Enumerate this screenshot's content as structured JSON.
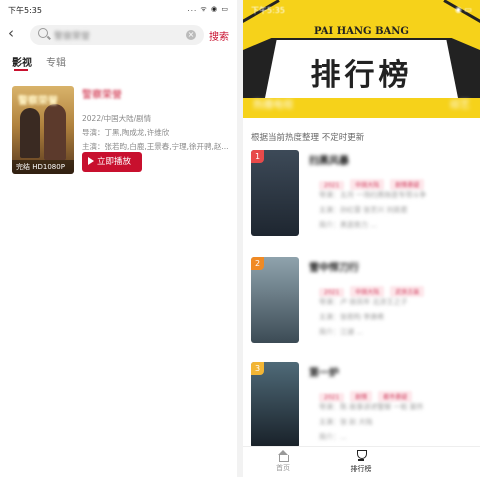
{
  "left": {
    "status": {
      "time": "下午5:35",
      "icons": "... ᯤ ◉ ▭"
    },
    "search": {
      "query": "警察荣誉",
      "action_label": "搜索"
    },
    "tabs": [
      {
        "label": "影视"
      },
      {
        "label": "专辑"
      }
    ],
    "result": {
      "title": "警察荣誉",
      "poster_title": "警察荣誉",
      "badge": "完结 HD1080P",
      "meta": "2022/中国大陆/剧情",
      "director": "导演：丁黑,陶成龙,许维欣",
      "cast": "主演：张若昀,白鹿,王景春,宁理,徐开骋,赵...",
      "play_label": "立即播放"
    }
  },
  "right": {
    "status": {
      "time": "下午5:35",
      "icons": "◉ ▭"
    },
    "banner": {
      "en_title": "PAI HANG BANG",
      "cn_title": "排行榜",
      "left_tab": "热播电视",
      "right_tab": "综艺"
    },
    "subtitle": "根据当前热度整理 不定时更新",
    "items": [
      {
        "rank": "1",
        "title": "扫黑风暴",
        "tags": [
          "2021",
          "中国大陆",
          "剧情悬疑"
        ],
        "desc": [
          "导演：五月 一场扫黑除恶专项斗争",
          "主演：孙红雷 张艺兴 刘奕君",
          "简介：黑恶势力 ..."
        ],
        "rank_color": "#e84a4a",
        "poster_colors": [
          "#3d4a58",
          "#1e2630"
        ]
      },
      {
        "rank": "2",
        "title": "雪中悍刀行",
        "tags": [
          "2021",
          "中国大陆",
          "武侠古装"
        ],
        "desc": [
          "导演：卢 徐凤年 北凉王之子",
          "主演：张若昀 李庚希",
          "简介：江湖 ..."
        ],
        "rank_color": "#f08a24",
        "poster_colors": [
          "#8fa3ad",
          "#3c4b55"
        ]
      },
      {
        "rank": "3",
        "title": "第一炉",
        "tags": [
          "2021",
          "剧情",
          "都市悬疑"
        ],
        "desc": [
          "导演：陈 故事讲述警察 一桩 案件",
          "主演：张 赵 大陆",
          "简介：..."
        ],
        "rank_color": "#f2b534",
        "poster_colors": [
          "#4f6a78",
          "#182028"
        ]
      }
    ],
    "tabbar": [
      {
        "label": "首页"
      },
      {
        "label": "排行榜"
      }
    ]
  }
}
